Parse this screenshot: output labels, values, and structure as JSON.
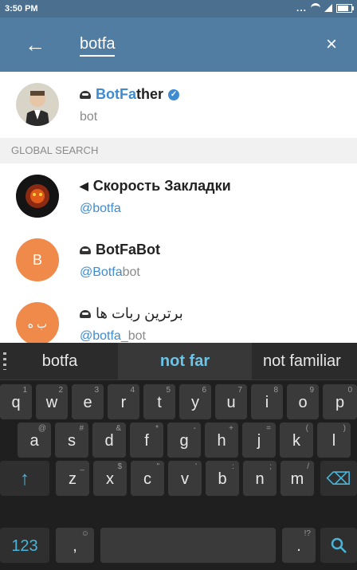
{
  "status": {
    "time": "3:50 PM",
    "dots": "..."
  },
  "search": {
    "back_icon": "←",
    "query": "botfa",
    "clear_icon": "×"
  },
  "results": [
    {
      "name_prefix": "",
      "name_match": "BotFa",
      "name_rest": "ther",
      "sub_match": "",
      "sub_rest": "bot",
      "verified": true
    },
    {
      "name_prefix": "",
      "name_match": "",
      "name_rest": "Скорость Закладки",
      "sub_match": "@botfa",
      "sub_rest": "",
      "avatar_type": "dark"
    },
    {
      "name_prefix": "",
      "name_match": "",
      "name_rest": "BotFaBot",
      "sub_match": "@Botfa",
      "sub_rest": "bot",
      "avatar_letter": "B"
    },
    {
      "name_prefix": "",
      "name_match": "",
      "name_rest": "برترین ربات ها",
      "sub_match": "@botfa",
      "sub_rest": "_bot",
      "avatar_letter": "ب ه"
    }
  ],
  "section_title": "GLOBAL SEARCH",
  "keyboard": {
    "suggestions": [
      "botfa",
      "not far",
      "not familiar"
    ],
    "row1": [
      {
        "label": "q",
        "hint": "1"
      },
      {
        "label": "w",
        "hint": "2"
      },
      {
        "label": "e",
        "hint": "3"
      },
      {
        "label": "r",
        "hint": "4"
      },
      {
        "label": "t",
        "hint": "5"
      },
      {
        "label": "y",
        "hint": "6"
      },
      {
        "label": "u",
        "hint": "7"
      },
      {
        "label": "i",
        "hint": "8"
      },
      {
        "label": "o",
        "hint": "9"
      },
      {
        "label": "p",
        "hint": "0"
      }
    ],
    "row2": [
      {
        "label": "a",
        "hint": "@"
      },
      {
        "label": "s",
        "hint": "#"
      },
      {
        "label": "d",
        "hint": "&"
      },
      {
        "label": "f",
        "hint": "*"
      },
      {
        "label": "g",
        "hint": "-"
      },
      {
        "label": "h",
        "hint": "+"
      },
      {
        "label": "j",
        "hint": "="
      },
      {
        "label": "k",
        "hint": "("
      },
      {
        "label": "l",
        "hint": ")"
      }
    ],
    "row3": [
      {
        "label": "z",
        "hint": "_"
      },
      {
        "label": "x",
        "hint": "$"
      },
      {
        "label": "c",
        "hint": "\""
      },
      {
        "label": "v",
        "hint": "'"
      },
      {
        "label": "b",
        "hint": ":"
      },
      {
        "label": "n",
        "hint": ";"
      },
      {
        "label": "m",
        "hint": "/"
      }
    ],
    "shift_icon": "↑",
    "backspace_icon": "⌫",
    "numbers_label": "123",
    "comma_label": ",",
    "comma_hint": "☺",
    "period_label": ".",
    "period_hint": "!?",
    "search_key_icon": "search-icon"
  }
}
